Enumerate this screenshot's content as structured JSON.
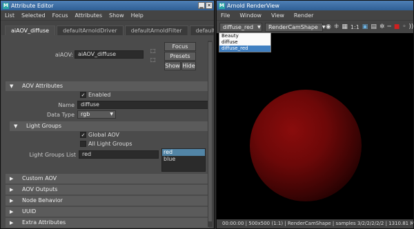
{
  "attr_editor": {
    "title": "Attribute Editor",
    "menu": [
      "List",
      "Selected",
      "Focus",
      "Attributes",
      "Show",
      "Help"
    ],
    "tabs": [
      "aiAOV_diffuse",
      "defaultArnoldDriver",
      "defaultArnoldFilter",
      "defaultArno"
    ],
    "aiaov_label": "aiAOV:",
    "aiaov_value": "aiAOV_diffuse",
    "focus_btn": "Focus",
    "presets_btn": "Presets",
    "show_btn": "Show",
    "hide_btn": "Hide",
    "aov_attributes": {
      "title": "AOV Attributes",
      "enabled_label": "Enabled",
      "name_label": "Name",
      "name_value": "diffuse",
      "datatype_label": "Data Type",
      "datatype_value": "rgb"
    },
    "light_groups": {
      "title": "Light Groups",
      "global_aov_label": "Global AOV",
      "all_light_groups_label": "All Light Groups",
      "list_label": "Light Groups List",
      "list_value": "red",
      "list_options": [
        "red",
        "blue"
      ]
    },
    "collapsed_sections": [
      "Custom AOV",
      "AOV Outputs",
      "Node Behavior",
      "UUID",
      "Extra Attributes"
    ]
  },
  "render_view": {
    "title": "Arnold RenderView",
    "menu": [
      "File",
      "Window",
      "View",
      "Render"
    ],
    "aov_dropdown_value": "diffuse_red",
    "camera_dropdown_value": "RenderCamShape",
    "ratio_label": "1:1",
    "aov_options": [
      "Beauty",
      "diffuse",
      "diffuse_red"
    ],
    "status": "00:00:00 | 500x500 (1:1) | RenderCamShape | samples 3/2/2/2/2/2 | 1310.81 M",
    "sphere_color": "#7a0a0a"
  }
}
